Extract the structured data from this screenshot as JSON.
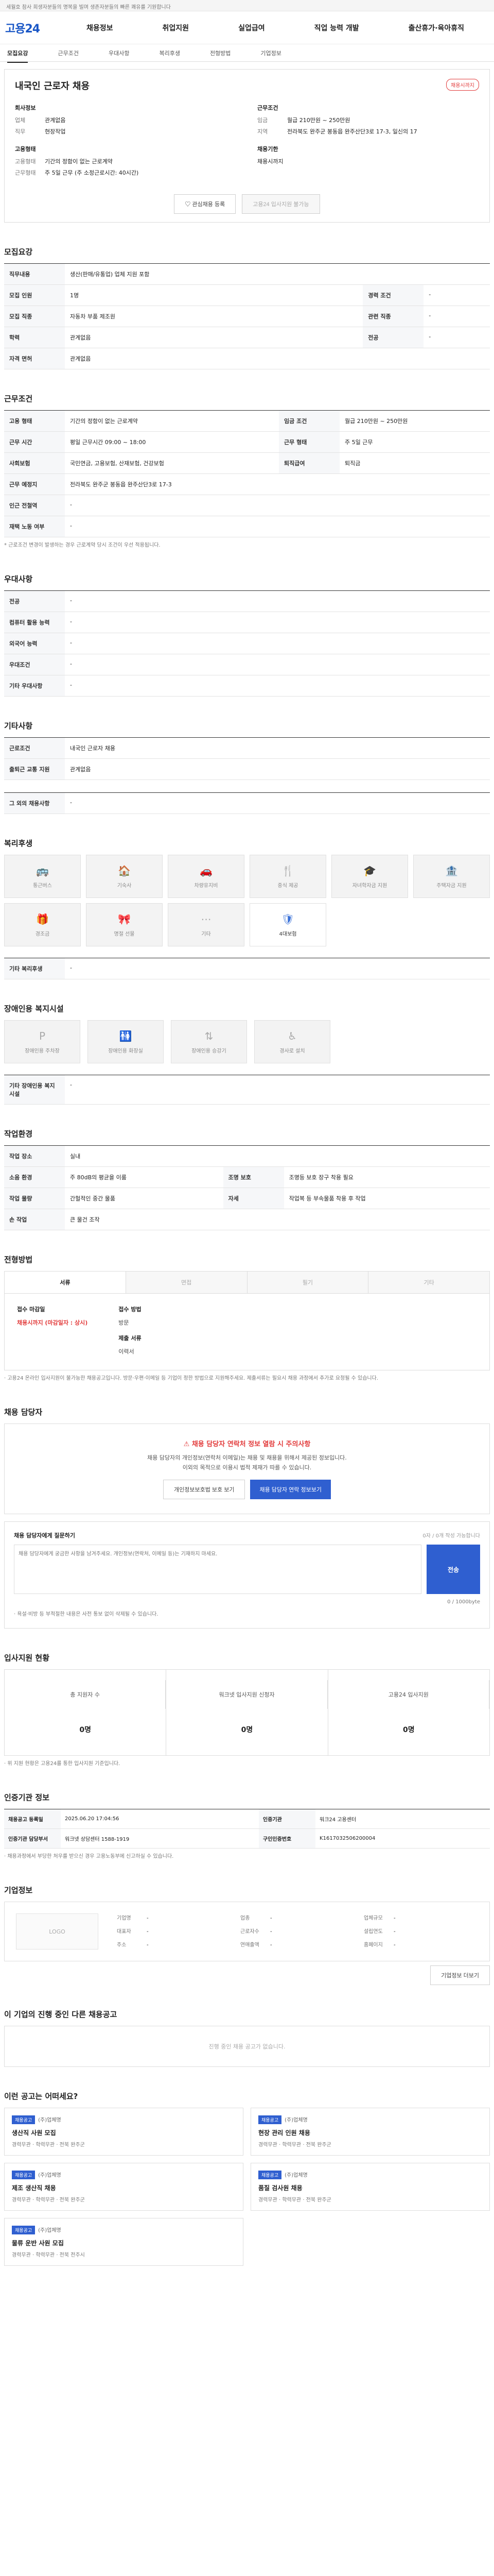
{
  "topbar": {
    "text": "세월호 참사 희생자분들의 명복을 빌며 생존자분들의 빠른 쾌유를 기원합니다"
  },
  "brand": "고용24",
  "gnb": [
    "채용정보",
    "취업지원",
    "실업급여",
    "직업 능력 개발",
    "출산휴가·육아휴직"
  ],
  "subnav": {
    "items": [
      "모집요강",
      "근무조건",
      "우대사항",
      "복리후생",
      "전형방법",
      "기업정보"
    ],
    "active": 0
  },
  "job": {
    "title": "내국인 근로자 채용",
    "badge": "채용시까지",
    "company": {
      "cap": "회사정보",
      "rows": [
        {
          "k": "업체",
          "v": "관계없음"
        },
        {
          "k": "직무",
          "v": "현장작업"
        }
      ]
    },
    "conditions": {
      "cap": "근무조건",
      "rows": [
        {
          "k": "임금",
          "v": "월급 210만원 ~ 250만원"
        },
        {
          "k": "지역",
          "v": "전라북도 완주군 봉동읍 완주산단3로 17-3, 일신의 17"
        }
      ]
    },
    "employ": {
      "cap": "고용형태",
      "rows": [
        {
          "k": "고용형태",
          "v": "기간의 정함이 없는 근로계약"
        },
        {
          "k": "근무형태",
          "v": "주 5일 근무 (주 소정근로시간: 40시간)"
        }
      ]
    },
    "period": {
      "cap": "채용기한",
      "rows": [
        {
          "k": "",
          "v": "채용시까지"
        }
      ]
    },
    "btn_bookmark": "관심채용 등록",
    "btn_share": "고용24 입사지원 불가능"
  },
  "recruit": {
    "title": "모집요강",
    "duty_label": "직무내용",
    "duty_value": "생산(판매/유통업) 업체 지원 포함",
    "rows": [
      [
        "모집 인원",
        "1명",
        "경력 조건",
        "-"
      ],
      [
        "모집 직종",
        "자동차 부품 제조원",
        "관련 직종",
        "-"
      ],
      [
        "학력",
        "관계없음",
        "전공",
        "-"
      ],
      [
        "자격 면허",
        "관계없음",
        "",
        ""
      ]
    ]
  },
  "workcond": {
    "title": "근무조건",
    "rows": [
      {
        "k": "고용 형태",
        "v": "기간의 정함이 없는 근로계약",
        "k2": "임금 조건",
        "v2": "월급 210만원 ~ 250만원"
      },
      {
        "k": "근무 시간",
        "v": "평일 근무시간 09:00 ~ 18:00",
        "k2": "근무 형태",
        "v2": "주 5일 근무"
      },
      {
        "k": "사회보험",
        "v": "국민연금, 고용보험, 산재보험, 건강보험",
        "k2": "퇴직급여",
        "v2": "퇴직금"
      },
      {
        "k": "근무 예정지",
        "v": "전라북도 완주군 봉동읍 완주산단3로 17-3",
        "k2": "",
        "v2": ""
      },
      {
        "k": "인근 전철역",
        "v": "-",
        "k2": "",
        "v2": ""
      },
      {
        "k": "재택 노동 여부",
        "v": "-",
        "k2": "",
        "v2": ""
      }
    ],
    "note": "* 근로조건 변경이 발생하는 경우 근로계약 당시 조건이 우선 적용됩니다."
  },
  "pref": {
    "title": "우대사항",
    "rows": [
      [
        "전공",
        "-"
      ],
      [
        "컴퓨터 활용 능력",
        "-"
      ],
      [
        "외국어 능력",
        "-"
      ],
      [
        "우대조건",
        "-"
      ],
      [
        "기타 우대사항",
        "-"
      ]
    ]
  },
  "etc": {
    "title": "기타사항",
    "rows": [
      [
        "근로조건",
        "내국인 근로자 채용"
      ],
      [
        "출퇴근 교통 지원",
        "관계없음"
      ]
    ],
    "sub_title": "그 외의 채용사항",
    "sub_value": "-"
  },
  "welfare": {
    "title": "복리후생",
    "items": [
      {
        "label": "통근버스",
        "icon": "bus-icon",
        "glyph": "🚌",
        "on": false
      },
      {
        "label": "기숙사",
        "icon": "dorm-icon",
        "glyph": "🏠",
        "on": false
      },
      {
        "label": "차량유지비",
        "icon": "car-icon",
        "glyph": "🚗",
        "on": false
      },
      {
        "label": "중식 제공",
        "icon": "meal-icon",
        "glyph": "🍴",
        "on": false
      },
      {
        "label": "자녀학자금 지원",
        "icon": "school-icon",
        "glyph": "🎓",
        "on": false
      },
      {
        "label": "주택자금 지원",
        "icon": "house-icon",
        "glyph": "🏦",
        "on": false
      },
      {
        "label": "경조금",
        "icon": "gift-icon",
        "glyph": "🎁",
        "on": false
      },
      {
        "label": "명절 선물",
        "icon": "present-icon",
        "glyph": "🎀",
        "on": false
      },
      {
        "label": "기타",
        "icon": "etc-icon",
        "glyph": "⋯",
        "on": false
      },
      {
        "label": "4대보험",
        "icon": "shield-icon",
        "glyph": "🛡",
        "on": true
      }
    ],
    "etc_label": "기타 복리후생",
    "etc_value": "-"
  },
  "disability": {
    "title": "장애인용 복지시설",
    "items": [
      {
        "label": "장애인용 주차장",
        "icon": "parking-icon",
        "glyph": "P"
      },
      {
        "label": "장애인용 화장실",
        "icon": "toilet-icon",
        "glyph": "🚻"
      },
      {
        "label": "장애인용 승강기",
        "icon": "elevator-icon",
        "glyph": "⇅"
      },
      {
        "label": "경사로 설치",
        "icon": "ramp-icon",
        "glyph": "♿"
      }
    ],
    "etc_label": "기타 장애인용 복지시설",
    "etc_value": "-"
  },
  "workplace": {
    "title": "작업환경",
    "rows": [
      [
        "작업 장소",
        "실내",
        "",
        ""
      ],
      [
        "소음 환경",
        "주 80dB의 평균을 이룸",
        "조명 보호",
        "조명등 보호 장구 착용 필요"
      ],
      [
        "작업 물량",
        "간헐적인 중간 물품",
        "자세",
        "작업복 등 부속물품 착용 후 작업"
      ],
      [
        "손 작업",
        "큰 물건 조작",
        "",
        ""
      ]
    ]
  },
  "selection": {
    "title": "전형방법",
    "tabs": [
      "서류",
      "면접",
      "필기",
      "기타"
    ],
    "active": 0,
    "period_cap": "접수 마감일",
    "period_value": "채용시까지 (마감일자 : 상시)",
    "method_cap": "접수 방법",
    "method_value": "방문",
    "doc_cap": "제출 서류",
    "doc_value": "이력서",
    "notes": "· 고용24 온라인 입사지원이 불가능한 채용공고입니다. 방문·우편·이메일 등 기업이 정한 방법으로 지원해주세요. 제출서류는 필요시 채용 과정에서 추가로 요청될 수 있습니다."
  },
  "contact": {
    "title": "채용 담당자",
    "warn": "채용 담당자 연락처 정보 열람 시 주의사항",
    "desc": "채용 담당자의 개인정보(연락처 이메일)는 채용 및 채용을 위해서 제공된 정보입니다.",
    "desc2": "이외의 목적으로 이용시 법적 제재가 따를 수 있습니다.",
    "btn_info": "개인정보보호법 보호 보기",
    "btn_view": "채용 담당자 연락 정보보기"
  },
  "inquiry": {
    "title": "채용 담당자에게 질문하기",
    "hint": "0자 / 0개 작성 가능합니다",
    "placeholder": "채용 담당자에게 궁금한 사항을 남겨주세요. 개인정보(연락처, 이메일 등)는 기재하지 마세요.",
    "counter": "0 / 1000byte",
    "submit": "전송",
    "notes": "· 욕설·비방 등 부적절한 내용은 사전 통보 없이 삭제될 수 있습니다."
  },
  "applicants": {
    "title": "입사지원 현황",
    "items": [
      {
        "label": "총 지원자 수",
        "value": "0명"
      },
      {
        "label": "워크넷 입사지원 신청자",
        "value": "0명"
      },
      {
        "label": "고용24 입사지원",
        "value": "0명"
      }
    ],
    "note": "· 위 지원 현황은 고용24를 통한 입사지원 기준입니다."
  },
  "notice_info": {
    "title": "인증기관 정보",
    "rows": [
      [
        "채용공고 등록일",
        "2025.06.20 17:04:56",
        "인증기관",
        "워크24 고용센터"
      ],
      [
        "인증기관 담당부서",
        "워크넷 상담센터 1588-1919",
        "구인인증번호",
        "K1617032506200004"
      ]
    ],
    "note": "· 채용과정에서 부당한 처우를 받으신 경우 고용노동부에 신고하실 수 있습니다."
  },
  "company": {
    "title": "기업정보",
    "logo": "LOGO",
    "rows": [
      [
        "기업명",
        "-"
      ],
      [
        "업종",
        "-"
      ],
      [
        "업체규모",
        "-"
      ],
      [
        "대표자",
        "-"
      ],
      [
        "근로자수",
        "-"
      ],
      [
        "설립연도",
        "-"
      ],
      [
        "주소",
        "-"
      ],
      [
        "연매출액",
        "-"
      ],
      [
        "홈페이지",
        "-"
      ]
    ],
    "btn_more": "기업정보 더보기"
  },
  "others": {
    "title": "이 기업의 진행 중인 다른 채용공고",
    "empty": "진행 중인 채용 공고가 없습니다."
  },
  "recommend": {
    "title": "이런 공고는 어떠세요?",
    "items": [
      {
        "tag": "채용공고",
        "company": "(주)업체명",
        "title": "생산직 사원 모집",
        "meta": "경력무관 · 학력무관 · 전북 완주군"
      },
      {
        "tag": "채용공고",
        "company": "(주)업체명",
        "title": "현장 관리 인원 채용",
        "meta": "경력무관 · 학력무관 · 전북 완주군"
      },
      {
        "tag": "채용공고",
        "company": "(주)업체명",
        "title": "제조 생산직 채용",
        "meta": "경력무관 · 학력무관 · 전북 완주군"
      },
      {
        "tag": "채용공고",
        "company": "(주)업체명",
        "title": "품질 검사원 채용",
        "meta": "경력무관 · 학력무관 · 전북 완주군"
      },
      {
        "tag": "채용공고",
        "company": "(주)업체명",
        "title": "물류 운반 사원 모집",
        "meta": "경력무관 · 학력무관 · 전북 전주시"
      }
    ]
  }
}
